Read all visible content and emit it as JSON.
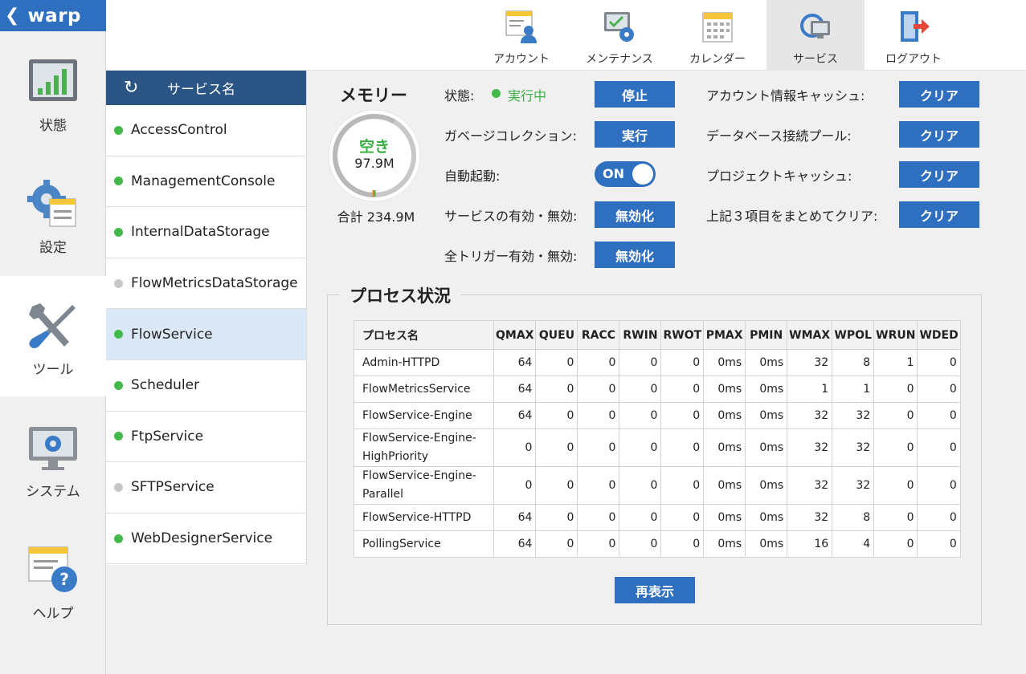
{
  "brand": {
    "back_icon": "chevron-left-icon",
    "name": "warp"
  },
  "nav": [
    {
      "label": "状態",
      "icon": "status-chart-icon",
      "active": false
    },
    {
      "label": "設定",
      "icon": "settings-gear-icon",
      "active": false
    },
    {
      "label": "ツール",
      "icon": "tools-icon",
      "active": true
    },
    {
      "label": "システム",
      "icon": "system-monitor-icon",
      "active": false
    },
    {
      "label": "ヘルプ",
      "icon": "help-icon",
      "active": false
    }
  ],
  "toolbar": [
    {
      "label": "アカウント",
      "icon": "account-icon",
      "active": false
    },
    {
      "label": "メンテナンス",
      "icon": "maintenance-icon",
      "active": false
    },
    {
      "label": "カレンダー",
      "icon": "calendar-icon",
      "active": false
    },
    {
      "label": "サービス",
      "icon": "service-icon",
      "active": true
    },
    {
      "label": "ログアウト",
      "icon": "logout-icon",
      "active": false
    }
  ],
  "services": {
    "header": "サービス名",
    "refresh_icon": "refresh-icon",
    "items": [
      {
        "name": "AccessControl",
        "status": "green"
      },
      {
        "name": "ManagementConsole",
        "status": "green"
      },
      {
        "name": "InternalDataStorage",
        "status": "green"
      },
      {
        "name": "FlowMetricsDataStorage",
        "status": "gray"
      },
      {
        "name": "FlowService",
        "status": "green",
        "selected": true
      },
      {
        "name": "Scheduler",
        "status": "green"
      },
      {
        "name": "FtpService",
        "status": "green"
      },
      {
        "name": "SFTPService",
        "status": "gray"
      },
      {
        "name": "WebDesignerService",
        "status": "green"
      }
    ]
  },
  "memory": {
    "title": "メモリー",
    "free_label": "空き",
    "free_value": "97.9M",
    "total": "合計 234.9M",
    "used_fraction": 0.583
  },
  "controls": {
    "status_label": "状態:",
    "status_value": "実行中",
    "stop_button": "停止",
    "gc_label": "ガベージコレクション:",
    "gc_button": "実行",
    "autostart_label": "自動起動:",
    "autostart_toggle": "ON",
    "service_enable_label": "サービスの有効・無効:",
    "service_enable_button": "無効化",
    "trigger_enable_label": "全トリガー有効・無効:",
    "trigger_enable_button": "無効化",
    "account_cache_label": "アカウント情報キャッシュ:",
    "db_pool_label": "データベース接続プール:",
    "project_cache_label": "プロジェクトキャッシュ:",
    "clear_all_label": "上記３項目をまとめてクリア:",
    "clear_button": "クリア"
  },
  "process": {
    "title": "プロセス状況",
    "columns": [
      "プロセス名",
      "QMAX",
      "QUEU",
      "RACC",
      "RWIN",
      "RWOT",
      "PMAX",
      "PMIN",
      "WMAX",
      "WPOL",
      "WRUN",
      "WDED"
    ],
    "rows": [
      {
        "name": "Admin-HTTPD",
        "cells": [
          "64",
          "0",
          "0",
          "0",
          "0",
          "0ms",
          "0ms",
          "32",
          "8",
          "1",
          "0"
        ]
      },
      {
        "name": "FlowMetricsService",
        "cells": [
          "64",
          "0",
          "0",
          "0",
          "0",
          "0ms",
          "0ms",
          "1",
          "1",
          "0",
          "0"
        ]
      },
      {
        "name": "FlowService-Engine",
        "cells": [
          "64",
          "0",
          "0",
          "0",
          "0",
          "0ms",
          "0ms",
          "32",
          "32",
          "0",
          "0"
        ]
      },
      {
        "name": "FlowService-Engine-HighPriority",
        "cells": [
          "0",
          "0",
          "0",
          "0",
          "0",
          "0ms",
          "0ms",
          "32",
          "32",
          "0",
          "0"
        ]
      },
      {
        "name": "FlowService-Engine-Parallel",
        "cells": [
          "0",
          "0",
          "0",
          "0",
          "0",
          "0ms",
          "0ms",
          "32",
          "32",
          "0",
          "0"
        ]
      },
      {
        "name": "FlowService-HTTPD",
        "cells": [
          "64",
          "0",
          "0",
          "0",
          "0",
          "0ms",
          "0ms",
          "32",
          "8",
          "0",
          "0"
        ]
      },
      {
        "name": "PollingService",
        "cells": [
          "64",
          "0",
          "0",
          "0",
          "0",
          "0ms",
          "0ms",
          "16",
          "4",
          "0",
          "0"
        ]
      }
    ],
    "refresh_button": "再表示"
  },
  "colors": {
    "primary": "#2e6fbf",
    "header_dark": "#2b5585",
    "running_green": "#3cb043",
    "selected_bg": "#dbe8f7"
  }
}
